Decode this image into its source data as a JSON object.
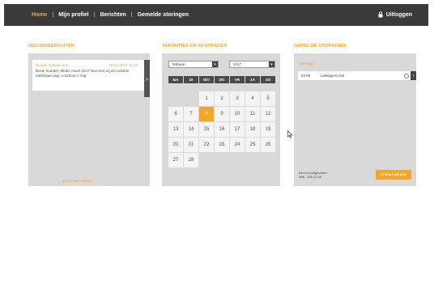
{
  "nav": {
    "items": [
      {
        "label": "Home",
        "active": true
      },
      {
        "label": "Mijn profiel",
        "active": false
      },
      {
        "label": "Berichten",
        "active": false
      },
      {
        "label": "Gemelde storingen",
        "active": false
      }
    ],
    "separator": "|",
    "logout_label": "Uitloggen",
    "logout_icon": "lock-icon"
  },
  "news": {
    "title": "NIEUWSBERICHTEN",
    "card_heading": "Update mobiele app",
    "card_date": "06-02-2017 12:10",
    "card_body": "Beste huurder, Medio maart 2017 lanceren wij de mobiele meldingen app, voordoor u nog",
    "more_link": "Lees meer nieuws ›"
  },
  "calendar": {
    "title": "VAKANTIES EN AFSPRAKEN",
    "month_value": "februari",
    "year_value": "2017",
    "weekdays": [
      "MA",
      "DI",
      "WO",
      "DO",
      "VR",
      "ZA",
      "ZO"
    ],
    "days": [
      "",
      "",
      "1",
      "2",
      "3",
      "4",
      "5",
      "6",
      "7",
      "8",
      "9",
      "10",
      "11",
      "12",
      "13",
      "14",
      "15",
      "16",
      "17",
      "18",
      "19",
      "20",
      "21",
      "22",
      "23",
      "24",
      "25",
      "26",
      "27",
      "28"
    ],
    "selected_day": "8"
  },
  "outages": {
    "title": "GEMELDE STORINGEN",
    "label": "Vandaag",
    "rows": [
      {
        "time": "22:00",
        "description": "Lekkage in hal"
      }
    ],
    "help_line1": "Bel in noodgevallen",
    "help_line2": "088 - 155 10 00",
    "report_button": "STORING MELDEN"
  },
  "colors": {
    "accent": "#f5a623",
    "topbar": "#3a3a3a",
    "panel": "#d9d9d9"
  }
}
